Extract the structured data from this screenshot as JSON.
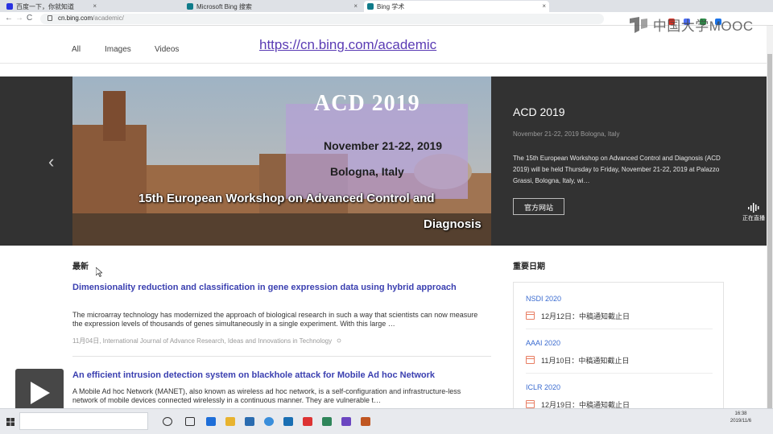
{
  "browser": {
    "tabs": [
      {
        "label": "百度一下，你就知道"
      },
      {
        "label": "Microsoft Bing 搜索"
      },
      {
        "label": "Bing 学术"
      }
    ],
    "url_host": "cn.bing.com",
    "url_path": "/academic/",
    "nav_back": "←",
    "nav_forward": "→",
    "nav_reload": "C",
    "tab_close": "×"
  },
  "watermark": "中国大学MOOC",
  "bing": {
    "nav": [
      "All",
      "Images",
      "Videos"
    ],
    "url_caption": "https://cn.bing.com/academic"
  },
  "carousel": {
    "prev_glyph": "‹",
    "banner": {
      "acd": "ACD 2019",
      "dates": "November 21-22, 2019",
      "place": "Bologna, Italy",
      "workshop_line1": "15th European Workshop on Advanced Control and",
      "workshop_line2": "Diagnosis"
    },
    "event_title": "ACD 2019",
    "event_meta": "November 21-22, 2019 Bologna, Italy",
    "event_desc": "The 15th European Workshop on Advanced Control and Diagnosis (ACD 2019) will be held Thursday to Friday, November 21-22, 2019 at Palazzo Grassi, Bologna, Italy, wi…",
    "official_label": "官方网站",
    "live_label": "正在直播"
  },
  "latest": {
    "heading": "最新",
    "articles": [
      {
        "title": "Dimensionality reduction and classification in gene expression data using hybrid approach",
        "snippet": "The microarray technology has modernized the approach of biological research in such a way that scientists can now measure the expression levels of thousands of genes simultaneously in a single experiment. With this large …",
        "meta": "11月04日, International Journal of Advance Research, Ideas and Innovations in Technology"
      },
      {
        "title": "An efficient intrusion detection system on blackhole attack for Mobile Ad hoc Network",
        "snippet": "A Mobile Ad hoc Network (MANET), also known as wireless ad hoc network, is a self-configuration and infrastructure-less network of mobile devices connected wirelessly in a continuous manner. They are vulnerable t…"
      }
    ]
  },
  "dates": {
    "heading": "重要日期",
    "items": [
      {
        "name": "NSDI 2020",
        "date": "12月12日：中稿通知截止日"
      },
      {
        "name": "AAAI 2020",
        "date": "11月10日：中稿通知截止日"
      },
      {
        "name": "ICLR 2020",
        "date": "12月19日：中稿通知截止日"
      }
    ]
  },
  "taskbar": {
    "time": "16:38",
    "date": "2019/11/6"
  },
  "colors": {
    "link": "#3a3fb0",
    "accent_purple": "#5a3bb4",
    "conf_link": "#3a6bd0",
    "calendar": "#e87e63",
    "carousel_bg": "#323232"
  }
}
